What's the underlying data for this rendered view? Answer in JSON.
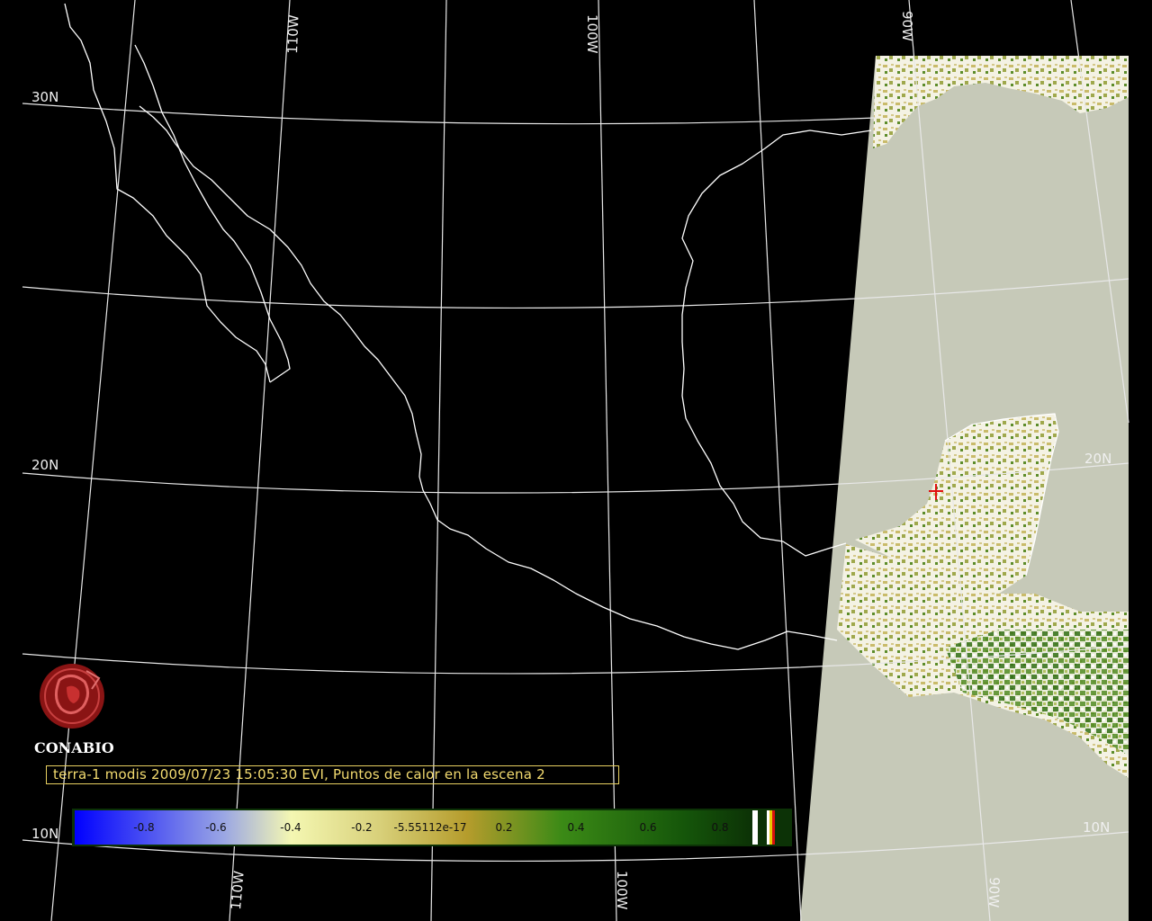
{
  "map": {
    "grid_labels": {
      "lat_30n": "30N",
      "lat_20n_left": "20N",
      "lat_20n_right": "20N",
      "lat_10n_left": "10N",
      "lat_10n_right": "10N",
      "lon_110w_top": "110W",
      "lon_100w_top": "100W",
      "lon_90w_top": "90W",
      "lon_110w_bottom": "110W",
      "lon_100w_bottom": "100W",
      "lon_90w_bottom": "90W"
    },
    "hotspot_marker": "red-cross-marker",
    "colors": {
      "background": "#000000",
      "grid": "#e8e8e8",
      "coastline": "#ffffff",
      "ocean_no_data": "#c6c9b8",
      "land_cloud": "#ffffff",
      "hotspot": "#e01010"
    }
  },
  "caption": {
    "text": "terra-1 modis 2009/07/23 15:05:30 EVI, Puntos de calor en la escena 2"
  },
  "logo": {
    "name": "CONABIO"
  },
  "colorbar": {
    "ticks": [
      "-0.8",
      "-0.6",
      "-0.4",
      "-0.2",
      "-5.55112e-17",
      "0.2",
      "0.4",
      "0.6",
      "0.8"
    ],
    "min": -1.0,
    "max": 1.0,
    "gradient": [
      "#0000ff",
      "#8c9ae0",
      "#f4f6b0",
      "#c8b23c",
      "#2a7a10",
      "#0e3a08"
    ]
  }
}
